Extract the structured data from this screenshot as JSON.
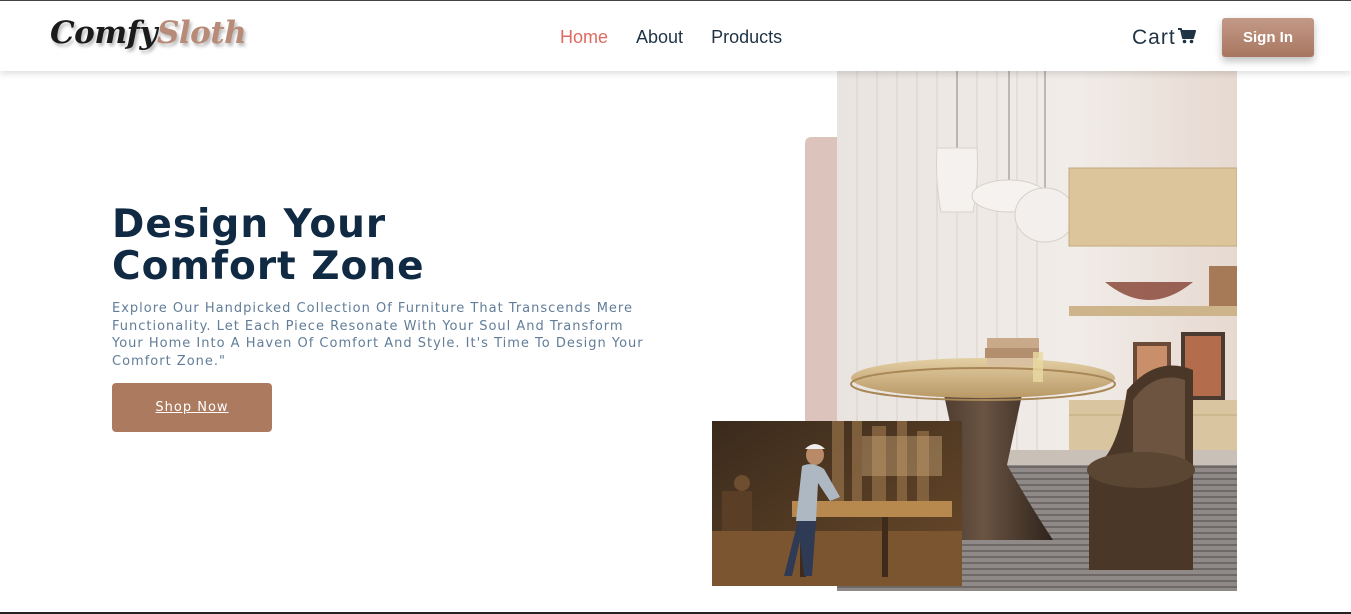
{
  "brand": {
    "part1": "Comfy",
    "part2": "Sloth"
  },
  "nav": {
    "links": [
      {
        "label": "Home",
        "active": true
      },
      {
        "label": "About",
        "active": false
      },
      {
        "label": "Products",
        "active": false
      }
    ],
    "cart_label": "Cart",
    "signin_label": "Sign In"
  },
  "hero": {
    "title_line1": "Design Your",
    "title_line2": "Comfort Zone",
    "description": "Explore Our Handpicked Collection Of Furniture That Transcends Mere Functionality. Let Each Piece Resonate With Your Soul And Transform Your Home Into A Haven Of Comfort And Style. It's Time To Design Your Comfort Zone.\"",
    "cta_label": "Shop Now"
  },
  "images": {
    "main": "dining-room-photo",
    "secondary": "carpenter-workshop-photo"
  },
  "colors": {
    "primary": "#ab7a5f",
    "heading": "#102a43",
    "text_muted": "#617d98",
    "nav_active": "#e06a60",
    "accent_bar": "#dcc4bc"
  }
}
